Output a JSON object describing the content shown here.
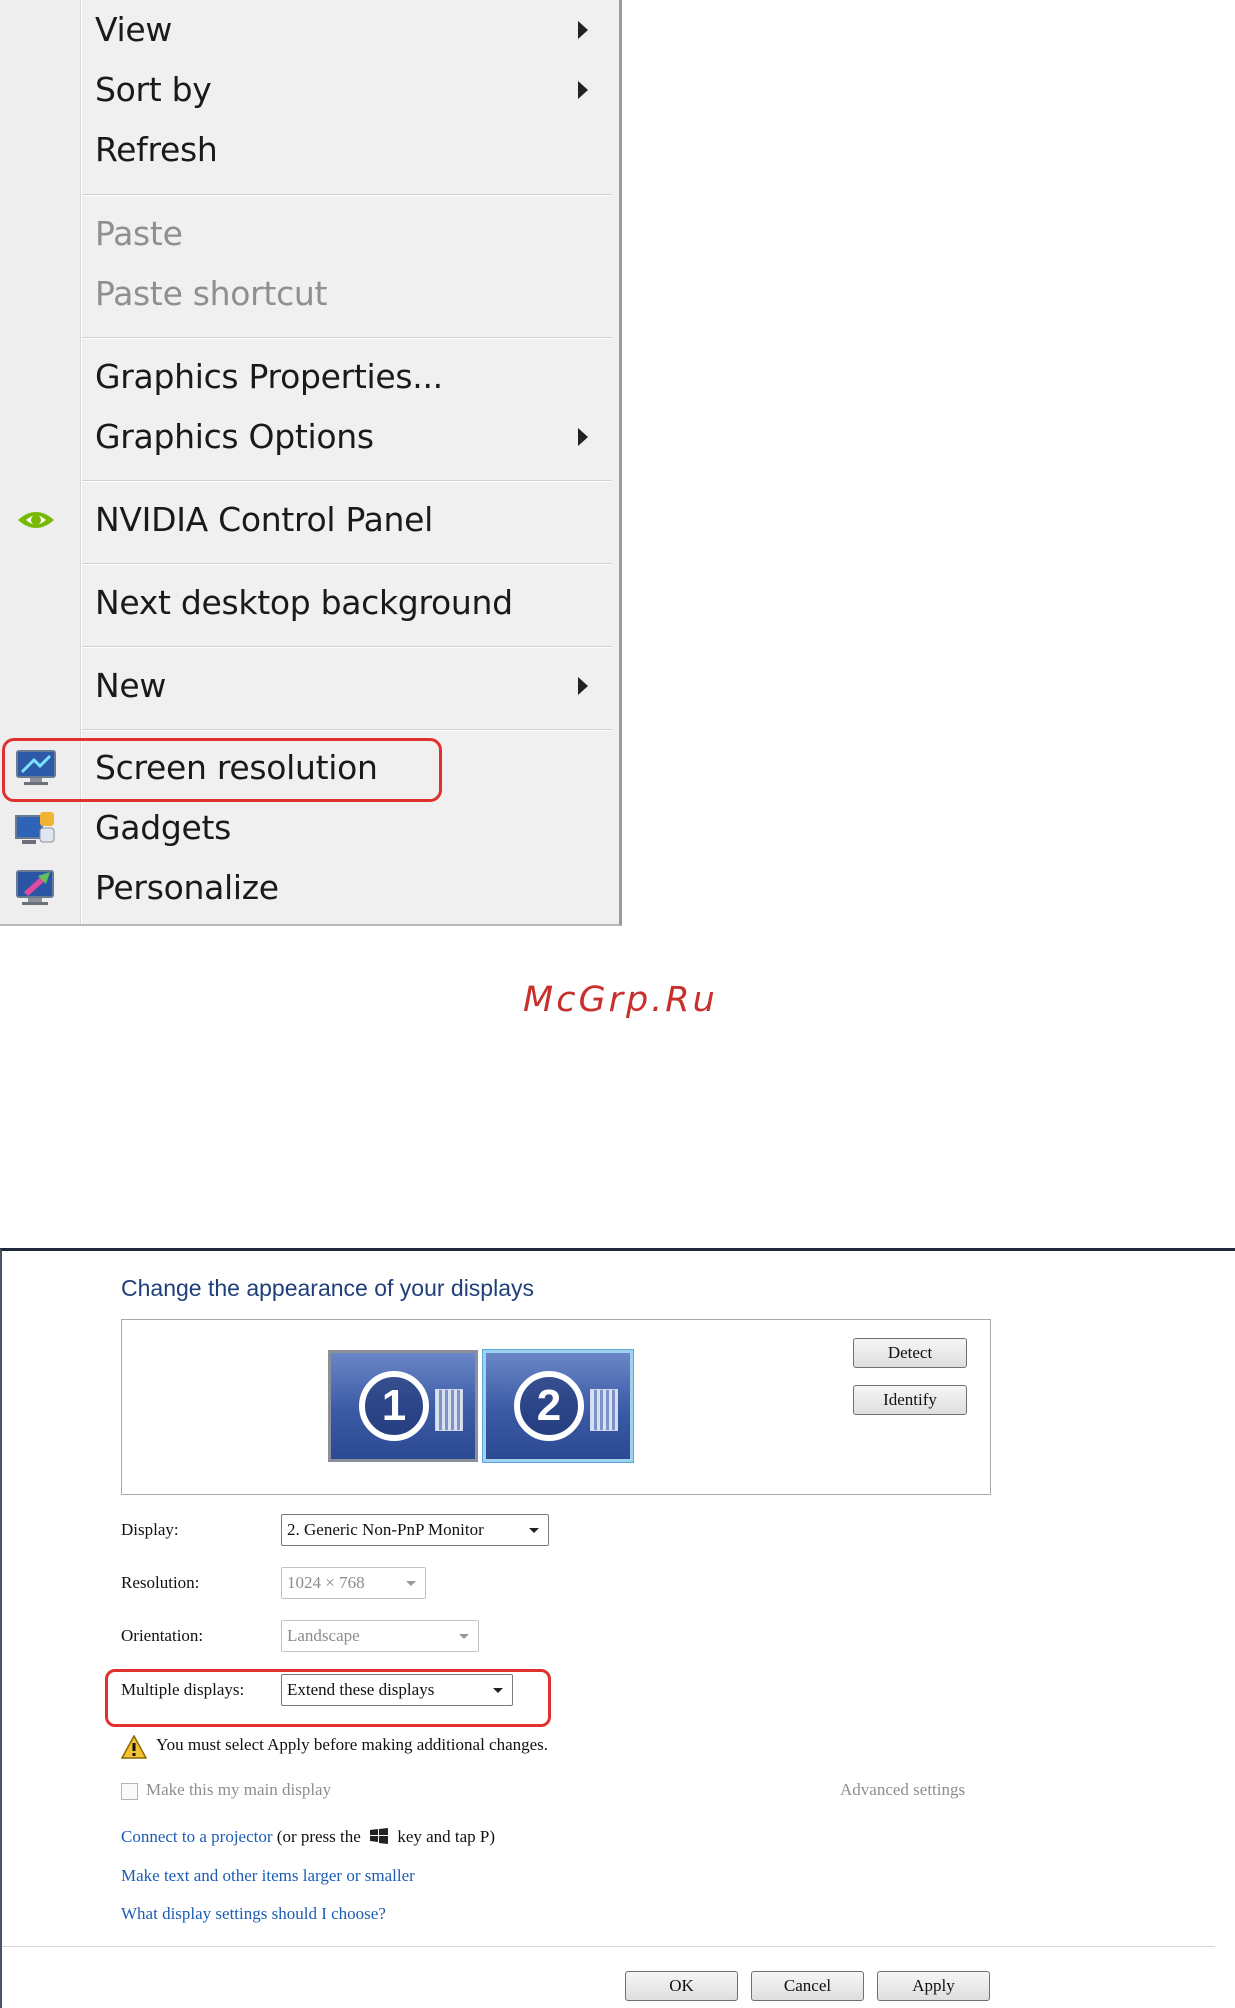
{
  "context_menu": {
    "items": [
      {
        "label": "View",
        "submenu": true,
        "disabled": false
      },
      {
        "label": "Sort by",
        "submenu": true,
        "disabled": false
      },
      {
        "label": "Refresh",
        "submenu": false,
        "disabled": false
      },
      {
        "label": "Paste",
        "submenu": false,
        "disabled": true
      },
      {
        "label": "Paste shortcut",
        "submenu": false,
        "disabled": true
      },
      {
        "label": "Graphics Properties...",
        "submenu": false,
        "disabled": false
      },
      {
        "label": "Graphics Options",
        "submenu": true,
        "disabled": false
      },
      {
        "label": "NVIDIA Control Panel",
        "submenu": false,
        "disabled": false,
        "icon": "nvidia-icon"
      },
      {
        "label": "Next desktop background",
        "submenu": false,
        "disabled": false
      },
      {
        "label": "New",
        "submenu": true,
        "disabled": false
      },
      {
        "label": "Screen resolution",
        "submenu": false,
        "disabled": false,
        "icon": "screen-resolution-icon",
        "highlighted": true
      },
      {
        "label": "Gadgets",
        "submenu": false,
        "disabled": false,
        "icon": "gadgets-icon"
      },
      {
        "label": "Personalize",
        "submenu": false,
        "disabled": false,
        "icon": "personalize-icon"
      }
    ]
  },
  "watermark": "McGrp.Ru",
  "dialog": {
    "title": "Change the appearance of your displays",
    "monitors": [
      {
        "number": "1",
        "selected": false
      },
      {
        "number": "2",
        "selected": true
      }
    ],
    "detect_label": "Detect",
    "identify_label": "Identify",
    "display_label": "Display:",
    "display_value": "2. Generic Non-PnP Monitor",
    "resolution_label": "Resolution:",
    "resolution_value": "1024 × 768",
    "orientation_label": "Orientation:",
    "orientation_value": "Landscape",
    "multiple_label": "Multiple displays:",
    "multiple_value": "Extend these displays",
    "warning_text": "You must select Apply before making additional changes.",
    "main_display_label": "Make this my main display",
    "advanced_label": "Advanced settings",
    "projector_link": "Connect to a projector",
    "projector_pre": "(or press the",
    "projector_post": "key and tap P)",
    "larger_link": "Make text and other items larger or smaller",
    "settings_link": "What display settings should I choose?",
    "ok_label": "OK",
    "cancel_label": "Cancel",
    "apply_label": "Apply"
  },
  "colors": {
    "highlight_red": "#e03030",
    "link_blue": "#1c5cb5",
    "title_blue": "#1f3f7a",
    "watermark_red": "#c8302c"
  }
}
